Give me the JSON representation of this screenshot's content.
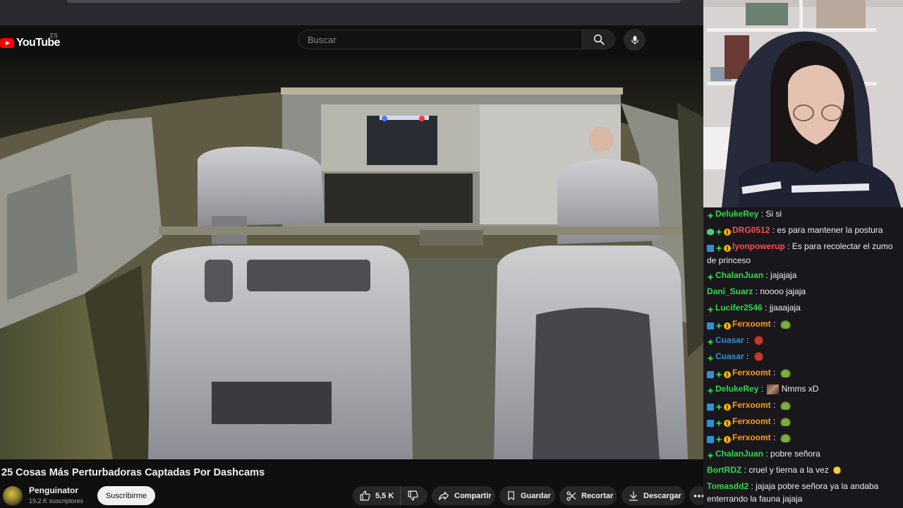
{
  "youtube": {
    "logo_text": "YouTube",
    "logo_country": "ES",
    "search": {
      "placeholder": "Buscar"
    },
    "video": {
      "title": "25 Cosas Más Perturbadoras Captadas Por Dashcams",
      "channel": "Penguinator",
      "subscribers": "19,2 K suscriptores",
      "subscribe_label": "Suscribirme",
      "likes": "5,5 K",
      "share_label": "Compartir",
      "save_label": "Guardar",
      "clip_label": "Recortar",
      "download_label": "Descargar"
    }
  },
  "chat": {
    "messages": [
      {
        "user": "DelukeRey",
        "color": "#2ed94d",
        "text": "Si si",
        "badges": [
          "green"
        ]
      },
      {
        "user": "DRG0512",
        "color": "#ff4d4d",
        "text": "es para mantener la postura",
        "badges": [
          "cube",
          "green",
          "coin"
        ]
      },
      {
        "user": "lyonpowerup",
        "color": "#ff4d4d",
        "text": "Es para recolectar el zumo de princeso",
        "badges": [
          "blue",
          "green",
          "coin"
        ]
      },
      {
        "user": "ChalanJuan",
        "color": "#2ed94d",
        "text": "jajajaja",
        "badges": [
          "green"
        ]
      },
      {
        "user": "Dani_Suarz",
        "color": "#2ed94d",
        "text": "noooo jajaja",
        "badges": []
      },
      {
        "user": "Lucifer2546",
        "color": "#2ed94d",
        "text": "jjaaajaja",
        "badges": [
          "green"
        ]
      },
      {
        "user": "Ferxoomt",
        "color": "#ff9a1f",
        "text": "",
        "badges": [
          "blue",
          "green",
          "coin"
        ],
        "emote": "turtle"
      },
      {
        "user": "Cuasar",
        "color": "#2f8fd8",
        "text": "",
        "badges": [
          "green"
        ],
        "emote": "red"
      },
      {
        "user": "Cuasar",
        "color": "#2f8fd8",
        "text": "",
        "badges": [
          "green"
        ],
        "emote": "red"
      },
      {
        "user": "Ferxoomt",
        "color": "#ff9a1f",
        "text": "",
        "badges": [
          "blue",
          "green",
          "coin"
        ],
        "emote": "turtle"
      },
      {
        "user": "DelukeRey",
        "color": "#2ed94d",
        "text": "Nmms xD",
        "badges": [
          "green"
        ],
        "emote": "pic"
      },
      {
        "user": "Ferxoomt",
        "color": "#ff9a1f",
        "text": "",
        "badges": [
          "blue",
          "green",
          "coin"
        ],
        "emote": "turtle"
      },
      {
        "user": "Ferxoomt",
        "color": "#ff9a1f",
        "text": "",
        "badges": [
          "blue",
          "green",
          "coin"
        ],
        "emote": "turtle"
      },
      {
        "user": "Ferxoomt",
        "color": "#ff9a1f",
        "text": "",
        "badges": [
          "blue",
          "green",
          "coin"
        ],
        "emote": "turtle"
      },
      {
        "user": "ChalanJuan",
        "color": "#2ed94d",
        "text": "pobre señora",
        "badges": [
          "green"
        ]
      },
      {
        "user": "BortRDZ",
        "color": "#2ed94d",
        "text": "cruel y tierna a la vez",
        "badges": [],
        "emote_after": "love"
      },
      {
        "user": "Tomasdd2",
        "color": "#2ed94d",
        "text": "jajaja pobre señora ya la andaba enterrando la fauna jajaja",
        "badges": []
      }
    ]
  }
}
